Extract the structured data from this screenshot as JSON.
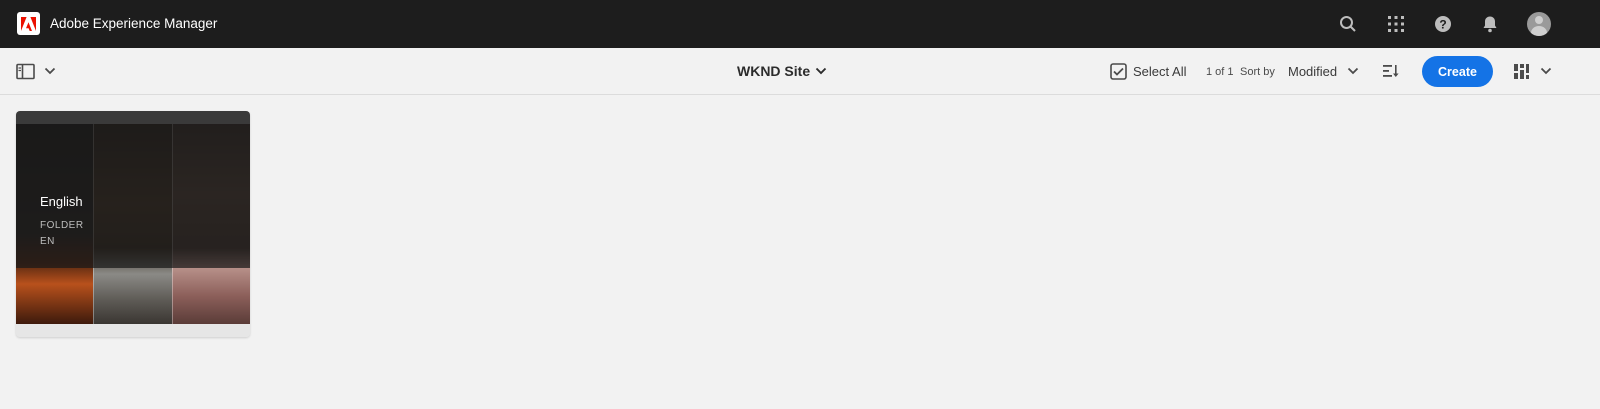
{
  "header": {
    "app_title": "Adobe Experience Manager",
    "icons": [
      "adobe-logo-icon",
      "search-icon",
      "apps-grid-icon",
      "help-icon",
      "bell-icon",
      "user-avatar"
    ]
  },
  "actionbar": {
    "site_title": "WKND Site",
    "select_all": "Select All",
    "pagination": "1 of 1",
    "sort_by_label": "Sort by",
    "sort_value": "Modified",
    "create_label": "Create"
  },
  "cards": [
    {
      "title": "English",
      "type": "FOLDER",
      "lang": "EN"
    }
  ],
  "colors": {
    "topbar": "#1d1d1d",
    "accent": "#1473e6",
    "background": "#f2f2f2",
    "logo_red": "#eb1000"
  }
}
